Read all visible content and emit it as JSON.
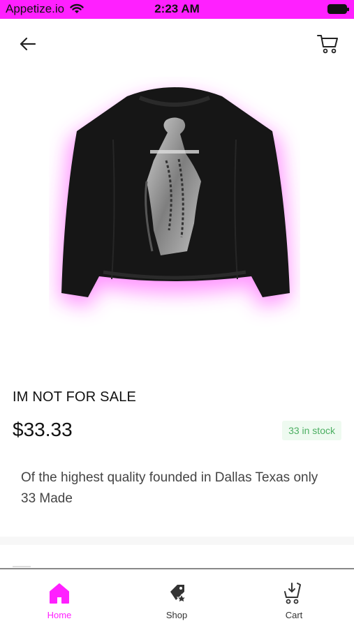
{
  "status_bar": {
    "carrier": "Appetize.io",
    "time": "2:23 AM"
  },
  "product": {
    "title": "IM NOT FOR SALE",
    "price": "$33.33",
    "stock": "33 in stock",
    "description": "Of the highest quality founded in Dallas Texas only 33 Made"
  },
  "nav": {
    "items": [
      {
        "label": "Home",
        "icon": "home-icon",
        "active": true
      },
      {
        "label": "Shop",
        "icon": "shop-tag-icon",
        "active": false
      },
      {
        "label": "Cart",
        "icon": "cart-icon",
        "active": false
      }
    ]
  },
  "colors": {
    "accent": "#ff20ff",
    "stock_text": "#4caf62",
    "stock_bg": "#eefaf0"
  }
}
